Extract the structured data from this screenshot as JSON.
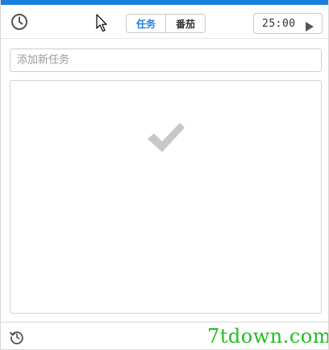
{
  "header": {
    "history_icon": "clock-icon",
    "tabs": [
      {
        "label": "任务",
        "active": true
      },
      {
        "label": "番茄",
        "active": false
      }
    ],
    "timer": {
      "time": "25:00",
      "play_icon": "play-icon"
    }
  },
  "task_input": {
    "placeholder": "添加新任务",
    "value": ""
  },
  "task_list": {
    "empty_icon": "checkmark-icon",
    "items": []
  },
  "footer": {
    "restore_icon": "history-restore-icon"
  },
  "watermark": {
    "text": "7tdown.com"
  },
  "colors": {
    "accent": "#1a7fdc",
    "check": "#c8c8c8",
    "watermark": "#1fbf1f"
  }
}
